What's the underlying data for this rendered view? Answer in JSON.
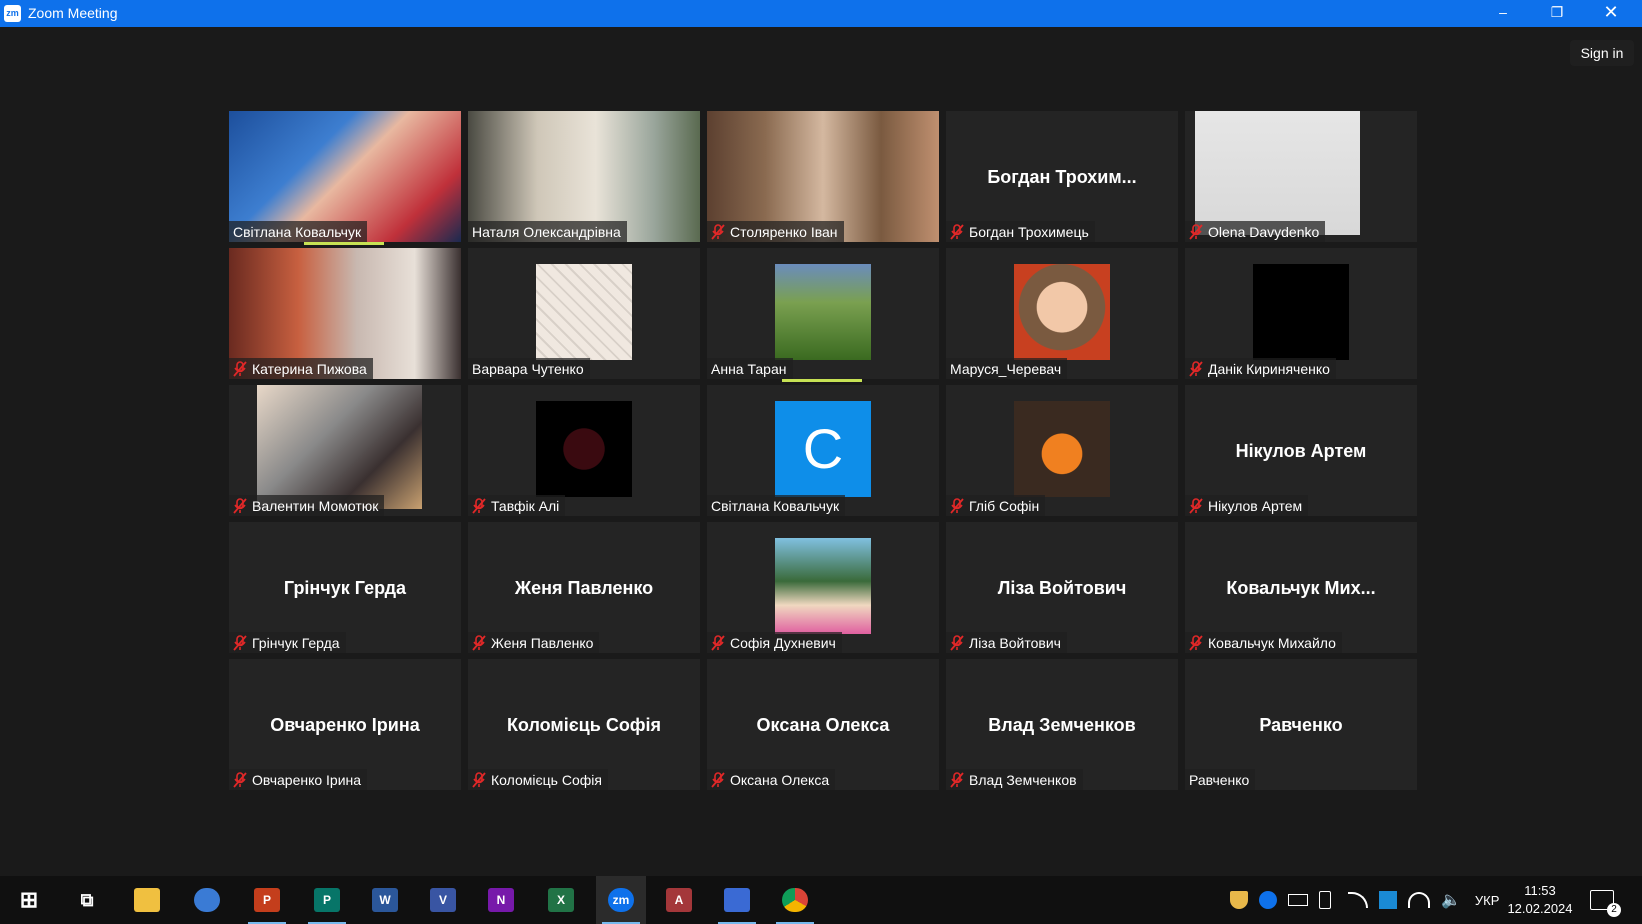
{
  "window": {
    "title": "Zoom Meeting",
    "logo_text": "zm",
    "minimize": "–",
    "restore": "❐",
    "close": "✕"
  },
  "header": {
    "sign_in": "Sign in"
  },
  "tiles": [
    {
      "display": "Світлана Ковальчук",
      "big": "",
      "muted": false,
      "active": false
    },
    {
      "display": "Наталя Олександрівна",
      "big": "",
      "muted": false,
      "active": true
    },
    {
      "display": "Столяренко Іван",
      "big": "",
      "muted": true,
      "active": false
    },
    {
      "display": "Богдан Трохимець",
      "big": "Богдан  Трохим...",
      "muted": true,
      "active": false
    },
    {
      "display": "Olena Davydenko",
      "big": "",
      "muted": true,
      "active": false
    },
    {
      "display": "Катерина Пижова",
      "big": "",
      "muted": true,
      "active": false
    },
    {
      "display": "Варвара Чутенко",
      "big": "",
      "muted": false,
      "active": false
    },
    {
      "display": "Анна Таран",
      "big": "",
      "muted": false,
      "active": false
    },
    {
      "display": "Маруся_Черевач",
      "big": "",
      "muted": false,
      "active": false
    },
    {
      "display": "Данік Кириняченко",
      "big": "",
      "muted": true,
      "active": false
    },
    {
      "display": "Валентин Момотюк",
      "big": "",
      "muted": true,
      "active": false
    },
    {
      "display": "Тавфік Алі",
      "big": "",
      "muted": true,
      "active": false
    },
    {
      "display": "Світлана Ковальчук",
      "big": "",
      "muted": false,
      "active": false,
      "avatar_letter": "C"
    },
    {
      "display": "Гліб Софін",
      "big": "",
      "muted": true,
      "active": false
    },
    {
      "display": "Нікулов Артем",
      "big": "Нікулов Артем",
      "muted": true,
      "active": false
    },
    {
      "display": "Грінчук Герда",
      "big": "Грінчук Герда",
      "muted": true,
      "active": false
    },
    {
      "display": "Женя Павленко",
      "big": "Женя Павленко",
      "muted": true,
      "active": false
    },
    {
      "display": "Софія Духневич",
      "big": "",
      "muted": true,
      "active": false
    },
    {
      "display": "Ліза Войтович",
      "big": "Ліза Войтович",
      "muted": true,
      "active": false
    },
    {
      "display": "Ковальчук Михайло",
      "big": "Ковальчук  Мих...",
      "muted": true,
      "active": false
    },
    {
      "display": "Овчаренко Ірина",
      "big": "Овчаренко Ірина",
      "muted": true,
      "active": false
    },
    {
      "display": "Коломієць Софія",
      "big": "Коломієць Софія",
      "muted": true,
      "active": false
    },
    {
      "display": "Оксана Олекса",
      "big": "Оксана Олекса",
      "muted": true,
      "active": false
    },
    {
      "display": "Влад Земченков",
      "big": "Влад Земченков",
      "muted": true,
      "active": false
    },
    {
      "display": "Равченко",
      "big": "Равченко",
      "muted": false,
      "active": false
    }
  ],
  "taskbar": {
    "apps": [
      {
        "name": "start",
        "label": "⊞"
      },
      {
        "name": "task-view",
        "label": "⧉"
      },
      {
        "name": "file-explorer",
        "label": ""
      },
      {
        "name": "onedrive",
        "label": ""
      },
      {
        "name": "powerpoint",
        "label": "P"
      },
      {
        "name": "publisher",
        "label": "P"
      },
      {
        "name": "word",
        "label": "W"
      },
      {
        "name": "visio",
        "label": "V"
      },
      {
        "name": "onenote",
        "label": "N"
      },
      {
        "name": "excel",
        "label": "X"
      },
      {
        "name": "zoom",
        "label": "zm"
      },
      {
        "name": "access",
        "label": "A"
      },
      {
        "name": "save-app",
        "label": ""
      },
      {
        "name": "chrome",
        "label": ""
      }
    ],
    "language": "УКР",
    "time": "11:53",
    "date": "12.02.2024",
    "notifications": "2"
  },
  "colors": {
    "titlebar": "#0e71eb",
    "active_speaker": "#c7e254",
    "mute_red": "#e02828",
    "avatar_blue": "#0e8ee9"
  }
}
